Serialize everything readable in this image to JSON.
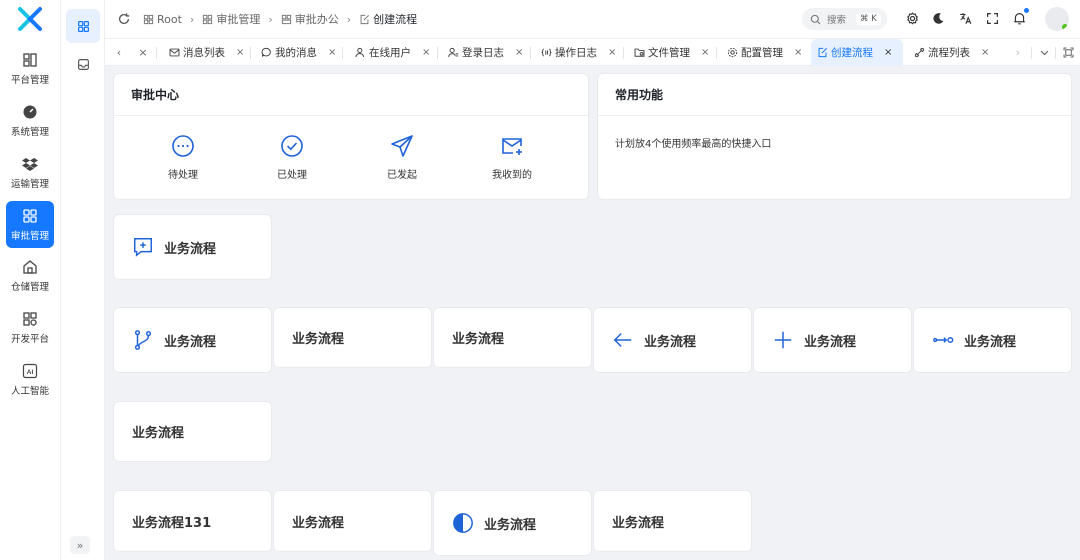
{
  "colors": {
    "accent": "#1677ff",
    "icon_blue": "#1f63d8",
    "status_online": "#52c41a"
  },
  "sidebar": {
    "items": [
      {
        "label": "平台管理",
        "icon": "platform-icon"
      },
      {
        "label": "系统管理",
        "icon": "dashboard-icon"
      },
      {
        "label": "运输管理",
        "icon": "dropbox-icon"
      },
      {
        "label": "审批管理",
        "icon": "grid-icon",
        "active": true
      },
      {
        "label": "仓储管理",
        "icon": "home-icon"
      },
      {
        "label": "开发平台",
        "icon": "apps-icon"
      },
      {
        "label": "人工智能",
        "icon": "ai-icon"
      }
    ]
  },
  "subsidebar": {
    "expand_label": "»"
  },
  "breadcrumb": [
    "Root",
    "审批管理",
    "审批办公",
    "创建流程"
  ],
  "search": {
    "placeholder": "搜索",
    "shortcut": "⌘ K"
  },
  "tabs": [
    {
      "label": "消息列表",
      "icon": "mail-icon"
    },
    {
      "label": "我的消息",
      "icon": "chat-icon"
    },
    {
      "label": "在线用户",
      "icon": "user-icon"
    },
    {
      "label": "登录日志",
      "icon": "user-log-icon"
    },
    {
      "label": "操作日志",
      "icon": "code-icon"
    },
    {
      "label": "文件管理",
      "icon": "folder-icon"
    },
    {
      "label": "配置管理",
      "icon": "gear-icon"
    },
    {
      "label": "创建流程",
      "icon": "edit-icon",
      "active": true
    },
    {
      "label": "流程列表",
      "icon": "flow-icon"
    }
  ],
  "approval_center": {
    "title": "审批中心",
    "actions": [
      {
        "label": "待处理",
        "icon": "pending-icon"
      },
      {
        "label": "已处理",
        "icon": "check-circle-icon"
      },
      {
        "label": "已发起",
        "icon": "send-icon"
      },
      {
        "label": "我收到的",
        "icon": "inbox-mail-icon"
      }
    ]
  },
  "common_functions": {
    "title": "常用功能",
    "hint": "计划放4个使用频率最高的快捷入口"
  },
  "flow_cards": [
    {
      "label": "业务流程",
      "icon": "message-plus-icon"
    },
    {
      "label": "业务流程",
      "icon": "branch-icon"
    },
    {
      "label": "业务流程",
      "icon": ""
    },
    {
      "label": "业务流程",
      "icon": ""
    },
    {
      "label": "业务流程",
      "icon": "arrow-left-icon"
    },
    {
      "label": "业务流程",
      "icon": "plus-icon"
    },
    {
      "label": "业务流程",
      "icon": "connect-icon"
    },
    {
      "label": "业务流程",
      "icon": ""
    },
    {
      "label": "业务流程131",
      "icon": ""
    },
    {
      "label": "业务流程",
      "icon": ""
    },
    {
      "label": "业务流程",
      "icon": "half-circle-icon"
    },
    {
      "label": "业务流程",
      "icon": ""
    }
  ]
}
